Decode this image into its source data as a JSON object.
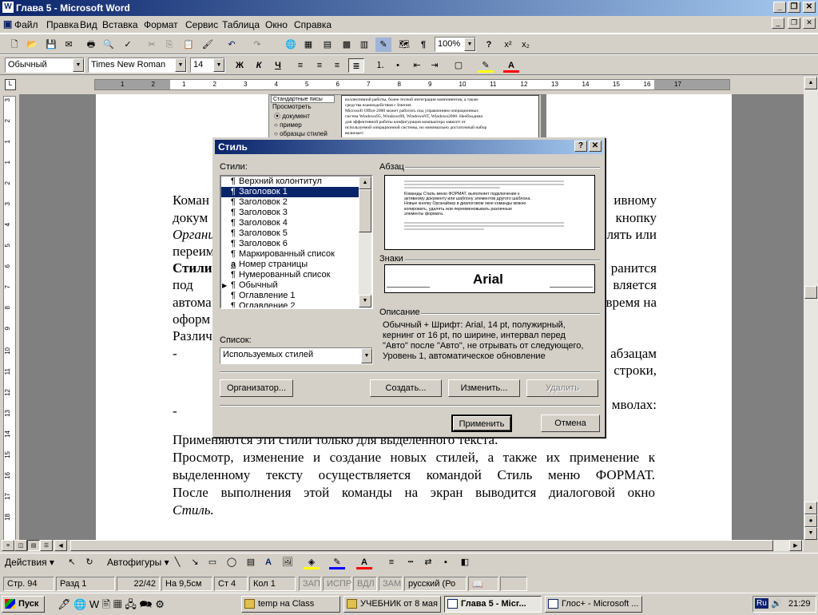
{
  "window": {
    "title": "Глава 5 - Microsoft Word",
    "icon": "W"
  },
  "menu": [
    "Файл",
    "Правка",
    "Вид",
    "Вставка",
    "Формат",
    "Сервис",
    "Таблица",
    "Окно",
    "Справка"
  ],
  "toolbar": {
    "zoom": "100%"
  },
  "formatting": {
    "style": "Обычный",
    "font": "Times New Roman",
    "size": "14",
    "bold": "Ж",
    "italic": "К",
    "underline": "Ч"
  },
  "ruler": {
    "ticks": [
      "1",
      "2",
      "1",
      "2",
      "3",
      "4",
      "5",
      "6",
      "7",
      "8",
      "9",
      "10",
      "11",
      "12",
      "13",
      "14",
      "15",
      "16",
      "17"
    ]
  },
  "vruler": {
    "ticks": [
      "3",
      "2",
      "1",
      "1",
      "2",
      "3",
      "4",
      "5",
      "6",
      "7",
      "8",
      "9",
      "10",
      "11",
      "12",
      "13",
      "14",
      "15",
      "16",
      "17",
      "18"
    ]
  },
  "bg_dialog_fragment": {
    "list_item": "Стандартные писы",
    "view_label": "Просмотреть",
    "options": [
      "документ",
      "пример",
      "образцы стилей"
    ],
    "para": [
      "коллективной работы, более тесной интеграции компонентов, а также",
      "средства взаимодействия с Internet.",
      "Microsoft Office 2000 может работать под управлением операционных",
      "систем Windows95, Windows98, WindowsNT, Windows2000. Необходима",
      "для эффективной работы конфигурация компьютера зависит от",
      "используемой операционной системы, но минимально достаточный набор",
      "включает:"
    ]
  },
  "document": {
    "lines_left": [
      "Коман",
      "докум",
      "Органи",
      "переим",
      "Стили",
      "под",
      "автома",
      "оформ",
      "Различ",
      "-",
      "",
      "-"
    ],
    "lines_right": [
      "ивному",
      "кнопку",
      "лять или",
      "",
      "ранится",
      "вляется",
      "время на",
      "",
      "",
      "абзацам",
      "строки,",
      "",
      "мволах:"
    ],
    "full_lines": [
      "Применяются эти стили только для выделенного текста.",
      "Просмотр, изменение и создание новых стилей, а также их применение к",
      "выделенному тексту осуществляется командой Стиль меню ФОРМАТ.",
      "После выполнения этой команды на экран выводится диалоговой окно",
      "Стиль."
    ]
  },
  "dialog": {
    "title": "Стиль",
    "styles_label": "Стили:",
    "styles": [
      {
        "sym": "¶",
        "label": "Верхний колонтитул",
        "marker": ""
      },
      {
        "sym": "¶",
        "label": "Заголовок 1",
        "marker": ""
      },
      {
        "sym": "¶",
        "label": "Заголовок 2",
        "marker": ""
      },
      {
        "sym": "¶",
        "label": "Заголовок 3",
        "marker": ""
      },
      {
        "sym": "¶",
        "label": "Заголовок 4",
        "marker": ""
      },
      {
        "sym": "¶",
        "label": "Заголовок 5",
        "marker": ""
      },
      {
        "sym": "¶",
        "label": "Заголовок 6",
        "marker": ""
      },
      {
        "sym": "¶",
        "label": "Маркированный список",
        "marker": ""
      },
      {
        "sym": "a",
        "label": "Номер страницы",
        "marker": ""
      },
      {
        "sym": "¶",
        "label": "Нумерованный список",
        "marker": ""
      },
      {
        "sym": "¶",
        "label": "Обычный",
        "marker": "▶"
      },
      {
        "sym": "¶",
        "label": "Оглавление 1",
        "marker": ""
      },
      {
        "sym": "¶",
        "label": "Оглавление 2",
        "marker": ""
      }
    ],
    "selected_index": 1,
    "list_label": "Список:",
    "list_value": "Используемых стилей",
    "paragraph_label": "Абзац",
    "paragraph_preview": [
      "Команды Стиль меню ФОРМАТ, выполняет подключение к",
      "активному документу или шаблону элементов другого шаблона.",
      "Новые кнопку Органайзер в диалоговом окне команды можно",
      "копировать, удалять или переименовывать различные",
      "элементы формата."
    ],
    "chars_label": "Знаки",
    "chars_font": "Arial",
    "description_label": "Описание",
    "description": [
      "Обычный + Шрифт: Arial, 14 pt, полужирный,",
      "кернинг от 16 pt, по ширине, интервал перед",
      "\"Авто\" после \"Авто\", не отрывать от следующего,",
      "Уровень 1, автоматическое обновление"
    ],
    "organizer": "Организатор...",
    "create": "Создать...",
    "modify": "Изменить...",
    "delete": "Удалить",
    "apply": "Применить",
    "cancel": "Отмена"
  },
  "drawing": {
    "actions": "Действия",
    "autoshapes": "Автофигуры"
  },
  "status": {
    "page": "Стр.  94",
    "section": "Разд  1",
    "pages": "22/42",
    "at": "На 9,5см",
    "line": "Ст  4",
    "col": "Кол  1",
    "rec": "ЗАП",
    "trk": "ИСПР",
    "ext": "ВДЛ",
    "ovr": "ЗАМ",
    "lang": "русский (Ро"
  },
  "taskbar": {
    "start": "Пуск",
    "tasks": [
      "temp на Class",
      "УЧЕБНИК от 8 мая",
      "Глава 5 - Micr...",
      "Глос+ - Microsoft ..."
    ],
    "lang": "Ru",
    "time": "21:29"
  }
}
